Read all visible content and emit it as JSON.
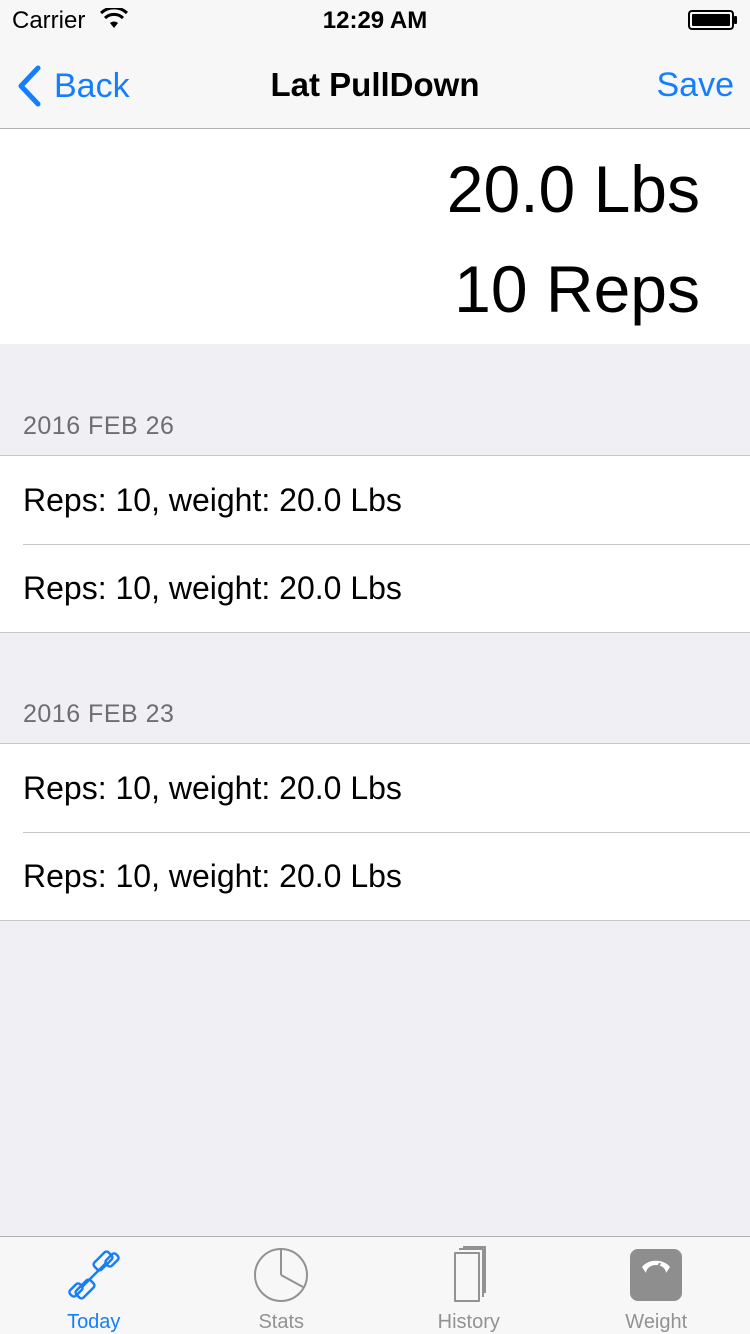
{
  "status_bar": {
    "carrier": "Carrier",
    "time": "12:29 AM"
  },
  "nav": {
    "back_label": "Back",
    "title": "Lat PullDown",
    "save_label": "Save"
  },
  "summary": {
    "weight": "20.0 Lbs",
    "reps": "10 Reps"
  },
  "sections": [
    {
      "header": "2016 FEB 26",
      "rows": [
        "Reps: 10, weight: 20.0 Lbs",
        "Reps: 10, weight: 20.0 Lbs"
      ]
    },
    {
      "header": "2016 FEB 23",
      "rows": [
        "Reps: 10, weight: 20.0 Lbs",
        "Reps: 10, weight: 20.0 Lbs"
      ]
    }
  ],
  "tabs": [
    {
      "label": "Today",
      "icon": "dumbbell-icon",
      "active": true
    },
    {
      "label": "Stats",
      "icon": "pie-chart-icon",
      "active": false
    },
    {
      "label": "History",
      "icon": "book-icon",
      "active": false
    },
    {
      "label": "Weight",
      "icon": "scale-icon",
      "active": false
    }
  ],
  "colors": {
    "accent": "#157efb",
    "inactive": "#929292",
    "background": "#efeff4"
  }
}
